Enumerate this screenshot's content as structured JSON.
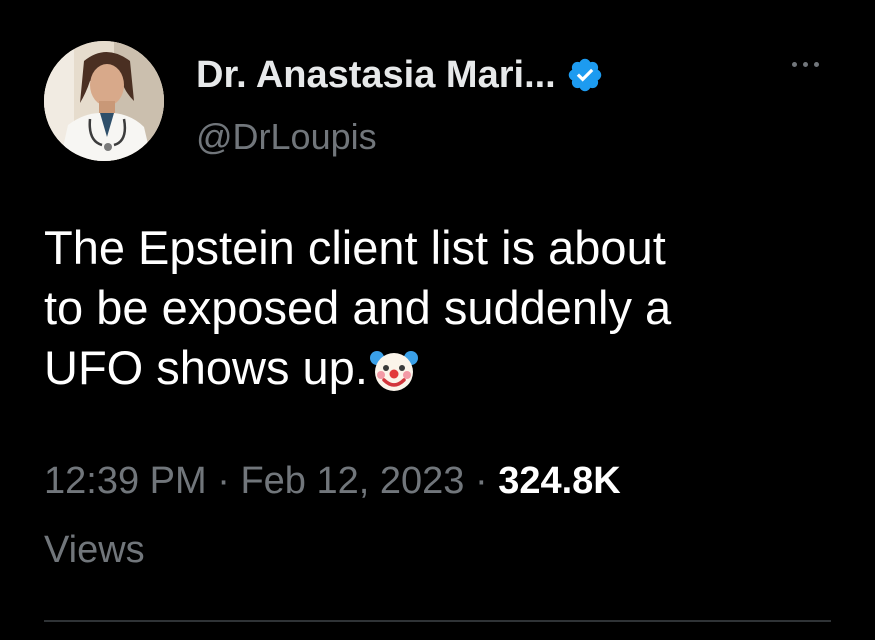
{
  "author": {
    "display_name": "Dr. Anastasia Mari...",
    "handle": "@DrLoupis",
    "verified": true,
    "verified_color": "#1d9bf0",
    "avatar_icon": "profile-photo"
  },
  "more_icon": "more-horizontal-icon",
  "tweet": {
    "lines": [
      "The Epstein client list is about",
      "to be exposed and suddenly a",
      "UFO shows up."
    ],
    "emoji": "clown-face-icon"
  },
  "meta": {
    "time": "12:39 PM",
    "separator": "·",
    "date": "Feb 12, 2023",
    "views_count": "324.8K",
    "views_label": "Views"
  },
  "colors": {
    "background": "#000000",
    "primary_text": "#e7e9ea",
    "secondary_text": "#71767b",
    "divider": "#2f3336"
  }
}
